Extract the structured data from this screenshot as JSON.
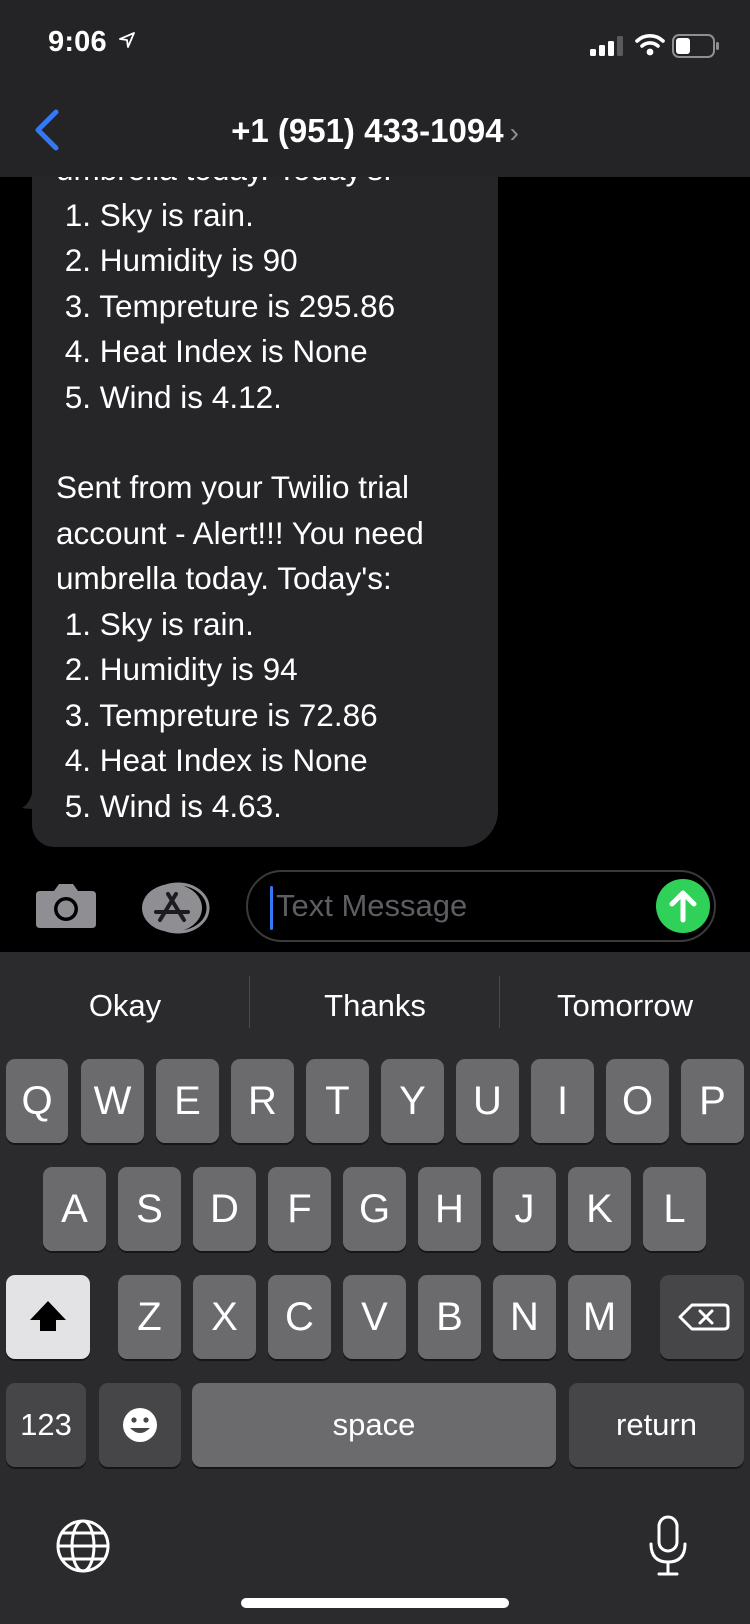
{
  "status_bar": {
    "time": "9:06"
  },
  "header": {
    "contact": "+1 (951) 433-1094",
    "chevron": "›"
  },
  "messages": [
    {
      "text": "umbrella today. Today's:\n 1. Sky is rain.\n 2. Humidity is 90\n 3. Tempreture is 295.86\n 4. Heat Index is None\n 5. Wind is 4.12."
    },
    {
      "text": "Sent from your Twilio trial\naccount - Alert!!! You need\numbrella today. Today's:\n 1. Sky is rain.\n 2. Humidity is 94\n 3. Tempreture is 72.86\n 4. Heat Index is None\n 5. Wind is 4.63."
    }
  ],
  "composer": {
    "placeholder": "Text Message"
  },
  "suggestions": [
    "Okay",
    "Thanks",
    "Tomorrow"
  ],
  "keyboard": {
    "row1": [
      "Q",
      "W",
      "E",
      "R",
      "T",
      "Y",
      "U",
      "I",
      "O",
      "P"
    ],
    "row2": [
      "A",
      "S",
      "D",
      "F",
      "G",
      "H",
      "J",
      "K",
      "L"
    ],
    "row3": [
      "Z",
      "X",
      "C",
      "V",
      "B",
      "N",
      "M"
    ],
    "numbers_key": "123",
    "space_key": "space",
    "return_key": "return"
  },
  "icons": {
    "location": "location-arrow-icon",
    "signal": "cellular-signal-icon",
    "wifi": "wifi-icon",
    "battery": "battery-icon",
    "back": "chevron-left-icon",
    "camera": "camera-icon",
    "app_store": "app-store-icon",
    "send": "arrow-up-icon",
    "shift": "shift-arrow-icon",
    "delete": "backspace-icon",
    "emoji": "emoji-icon",
    "globe": "globe-icon",
    "mic": "microphone-icon"
  },
  "colors": {
    "accent": "#3478f6",
    "send": "#30d158",
    "bubble": "#262629"
  }
}
